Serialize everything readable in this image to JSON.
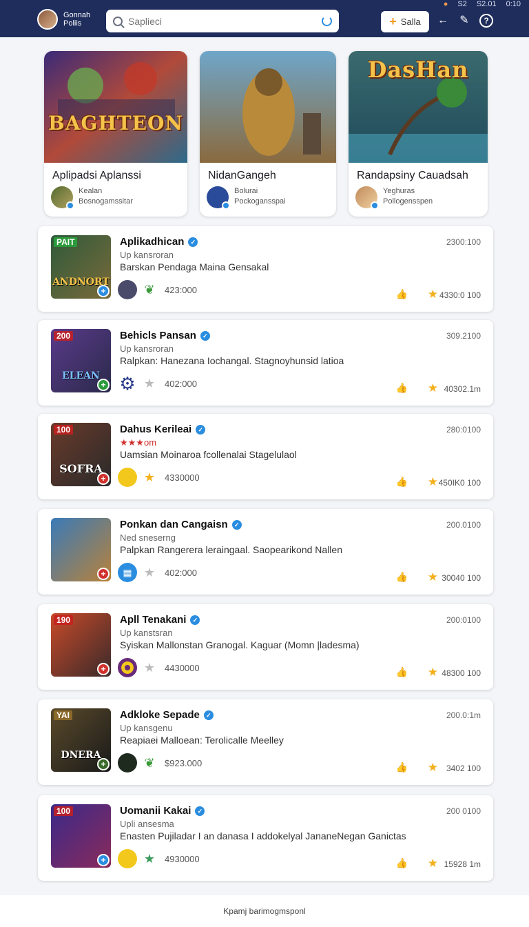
{
  "status": {
    "left": "S2",
    "middle": "S2.01",
    "right": "0:10"
  },
  "header": {
    "brand_line1": "Gonnah",
    "brand_line2": "Poliis",
    "search_placeholder": "Saplieci",
    "action_label": "Salla"
  },
  "featured": [
    {
      "title": "Aplipadsi Aplanssi",
      "logo": "BAGHTEON",
      "author": "Kealan",
      "meta": "Bosnogamssitar"
    },
    {
      "title": "NidanGangeh",
      "logo": "",
      "author": "Bolurai",
      "meta": "Pockogansspai"
    },
    {
      "title": "Randapsiny Cauadsah",
      "logo": "DasHan",
      "author": "Yeghuras",
      "meta": "Pollogensspen"
    }
  ],
  "apps": [
    {
      "title": "Aplikadhican",
      "sub": "Up kansroran",
      "desc": "Barskan Pendaga Maina Gensakal",
      "tag": "PAIT",
      "logo": "ANDNORT",
      "count": "423:000",
      "date": "2300:100",
      "score": "4330:0 100",
      "ico2": "leaf"
    },
    {
      "title": "Behicls Pansan",
      "sub": "Up kansroran",
      "desc": "Ralpkan: Hanezana Iochangal. Stagnoyhunsid latioa",
      "tag": "200",
      "logo": "ELEAN",
      "count": "402:000",
      "date": "309.2100",
      "score": "40302.1m",
      "ico2": "star"
    },
    {
      "title": "Dahus Kerileai",
      "sub": "★★★om",
      "desc": "Uamsian Moinaroa fcollenalai Stagelulaol",
      "tag": "100",
      "logo": "SOFRA",
      "count": "4330000",
      "date": "280:0100",
      "score": "450IK0 100",
      "ico2": "star"
    },
    {
      "title": "Ponkan dan Cangaisn",
      "sub": "Ned sneserng",
      "desc": "Palpkan Rangerera leraingaal. Saopearikond Nallen",
      "tag": "",
      "logo": "",
      "count": "402:000",
      "date": "200.0100",
      "score": "30040 100",
      "ico2": "star"
    },
    {
      "title": "Apll Tenakani",
      "sub": "Up kanstsran",
      "desc": "Syiskan Mallonstan Granogal.  Kaguar (Momn |ladesma)",
      "tag": "190",
      "logo": "",
      "count": "4430000",
      "date": "200:0100",
      "score": "48300 100",
      "ico2": "star"
    },
    {
      "title": "Adkloke Sepade",
      "sub": "Up kansgenu",
      "desc": "Reapiaei Malloean: Terolicalle Meelley",
      "tag": "YAI",
      "logo": "DNERA",
      "count": "$923.000",
      "date": "200.0:1m",
      "score": "3402 100",
      "ico2": "leaf"
    },
    {
      "title": "Uomanii Kakai",
      "sub": "Upli ansesma",
      "desc": "Enasten Pujiladar I an danasa I addokelyal JananeNegan Ganictas",
      "tag": "100",
      "logo": "",
      "count": "4930000",
      "date": "200 0100",
      "score": "15928 1m",
      "ico2": "star-green"
    }
  ],
  "footer": {
    "text": "Kpamj barimogmsponl"
  }
}
